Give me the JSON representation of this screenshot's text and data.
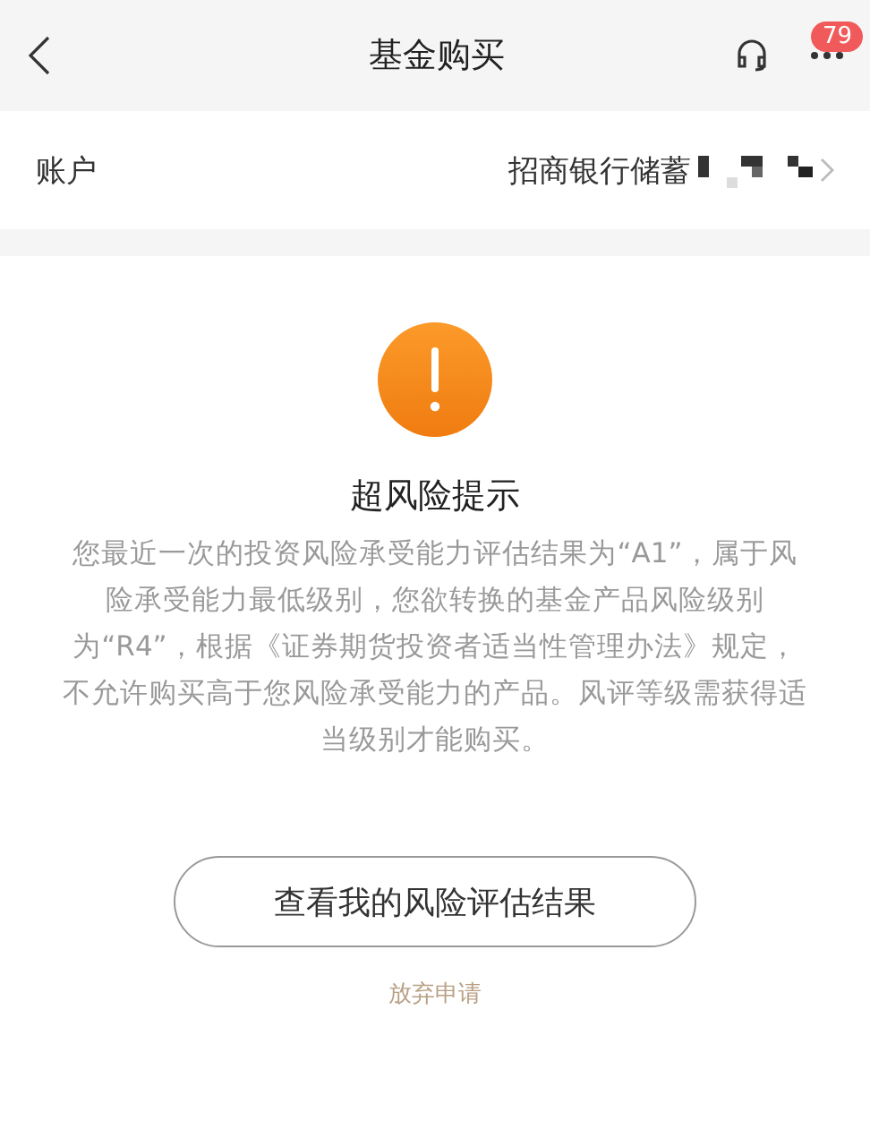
{
  "header": {
    "title": "基金购买",
    "badge": "79"
  },
  "account": {
    "label": "账户",
    "value": "招商银行储蓄"
  },
  "alert": {
    "title": "超风险提示",
    "message": "您最近一次的投资风险承受能力评估结果为“A1”，属于风险承受能力最低级别，您欲转换的基金产品风险级别为“R4”，根据《证券期货投资者适当性管理办法》规定，不允许购买高于您风险承受能力的产品。风评等级需获得适当级别才能购买。"
  },
  "buttons": [
    {
      "kind": "outline",
      "label": "查看我的风险评估结果"
    },
    {
      "kind": "link",
      "label": "放弃申请"
    }
  ]
}
